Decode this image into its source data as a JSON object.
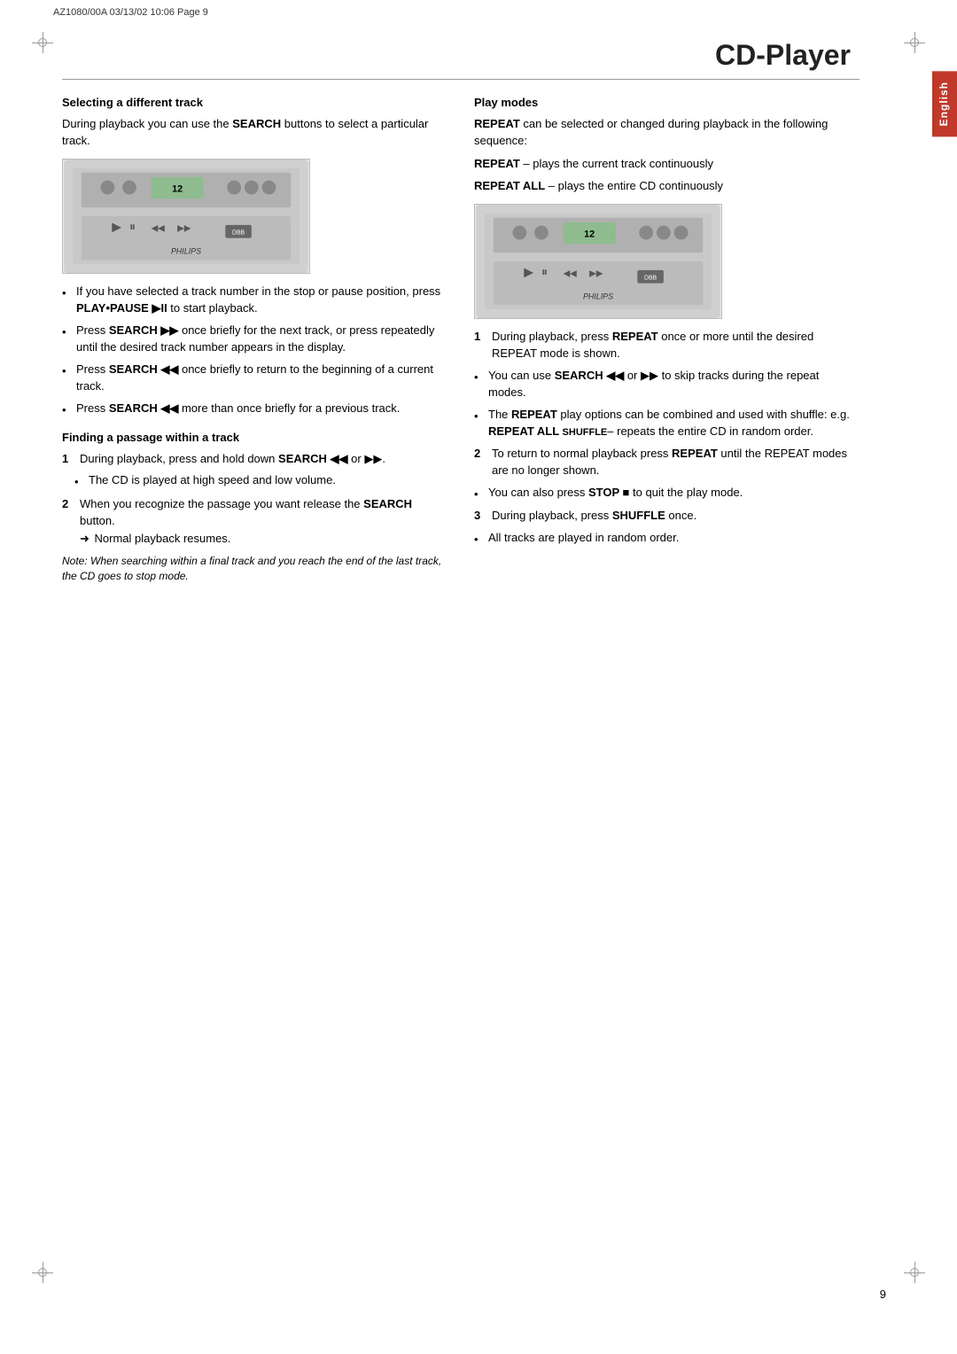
{
  "header": {
    "left_text": "AZ1080/00A   03/13/02  10:06   Page  9",
    "page_number": "9"
  },
  "lang_tab": "English",
  "title": "CD-Player",
  "left_column": {
    "section1": {
      "title": "Selecting a different track",
      "intro": "During playback you can use the",
      "search_bold": "SEARCH",
      "intro2": "buttons to select a particular track.",
      "bullets": [
        {
          "text_before": "If you have selected a track number in the stop or pause position, press ",
          "bold": "PLAY•PAUSE ▶II",
          "text_after": " to start playback."
        },
        {
          "text_before": "Press ",
          "bold": "SEARCH ▶▶",
          "text_after": " once briefly for the next track, or press repeatedly until the desired track number appears in the display."
        },
        {
          "text_before": "Press ",
          "bold": "SEARCH ◀◀",
          "text_after": " once briefly to return to the beginning of a current track."
        },
        {
          "text_before": "Press ",
          "bold": "SEARCH ◀◀",
          "text_after": " more than once briefly for a previous track."
        }
      ]
    },
    "section2": {
      "title": "Finding a passage within a track",
      "steps": [
        {
          "num": "1",
          "text_before": "During playback, press and hold down ",
          "bold": "SEARCH ◀◀",
          "text_after": " or ▶▶."
        }
      ],
      "sub_bullets": [
        {
          "text": "The CD is played at high speed and low volume."
        }
      ],
      "steps2": [
        {
          "num": "2",
          "text_before": "When you recognize the passage you want release the ",
          "bold": "SEARCH",
          "text_after": " button.",
          "arrow_text": "➜ Normal playback resumes."
        }
      ],
      "note": "Note: When searching within a final track and you reach the end of the last track, the CD goes to stop mode."
    }
  },
  "right_column": {
    "section1": {
      "title": "Play modes",
      "intro_before": "",
      "bold1": "REPEAT",
      "intro1": " can be selected or changed during playback in the following sequence:",
      "repeat_line": {
        "bold": "REPEAT",
        "text": " – plays the current track continuously"
      },
      "repeat_all_line": {
        "bold": "REPEAT ALL",
        "text": " – plays the entire CD continuously"
      },
      "steps": [
        {
          "num": "1",
          "text_before": "During playback, press ",
          "bold": "REPEAT",
          "text_after": " once or more until the desired REPEAT mode is shown."
        }
      ],
      "bullets": [
        {
          "text_before": "You can use ",
          "bold": "SEARCH ◀◀",
          "text_after": " or ▶▶ to skip tracks during the repeat modes."
        },
        {
          "text_before": "The ",
          "bold": "REPEAT",
          "text_after": " play options can be combined and used with shuffle: e.g. ",
          "bold2": "REPEAT ALL SHUFFLE",
          "text_after2": "– repeats the entire CD in random order."
        }
      ],
      "steps2": [
        {
          "num": "2",
          "text_before": "To return to normal playback press ",
          "bold": "REPEAT",
          "text_after": " until the REPEAT modes are no longer shown."
        }
      ],
      "bullets2": [
        {
          "text_before": "You can also press ",
          "bold": "STOP ■",
          "text_after": " to quit the play mode."
        }
      ],
      "steps3": [
        {
          "num": "3",
          "text_before": "During playback, press ",
          "bold": "SHUFFLE",
          "text_after": " once."
        }
      ],
      "bullets3": [
        {
          "text": "All tracks are played in random order."
        }
      ]
    }
  }
}
